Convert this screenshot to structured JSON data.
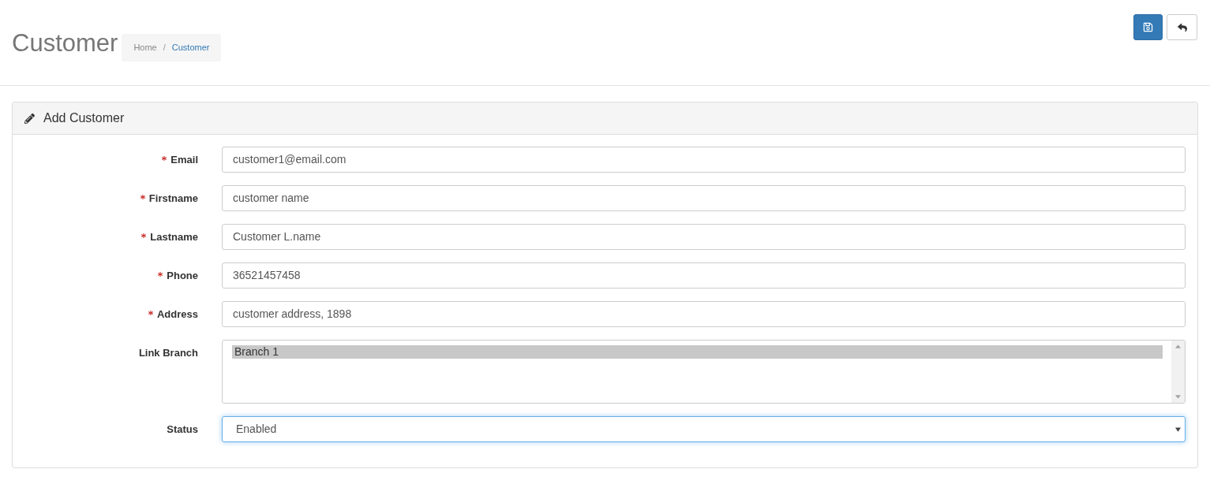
{
  "header": {
    "title": "Customer",
    "breadcrumb": {
      "separator": "/",
      "items": [
        {
          "label": "Home",
          "selected": false
        },
        {
          "label": "Customer",
          "selected": true
        }
      ]
    },
    "toolbar": [
      {
        "kind": "save"
      },
      {
        "kind": "back"
      }
    ]
  },
  "panel": {
    "title": "Add Customer",
    "fields": [
      {
        "kind": "text",
        "label": "Email",
        "required": true,
        "focused": false,
        "value": "customer1@email.com"
      },
      {
        "kind": "text",
        "label": "Firstname",
        "required": true,
        "focused": false,
        "value": "customer name"
      },
      {
        "kind": "text",
        "label": "Lastname",
        "required": true,
        "focused": false,
        "value": "Customer L.name"
      },
      {
        "kind": "text",
        "label": "Phone",
        "required": true,
        "focused": false,
        "value": "36521457458"
      },
      {
        "kind": "text",
        "label": "Address",
        "required": true,
        "focused": false,
        "value": "customer address, 1898"
      },
      {
        "kind": "multiselect",
        "label": "Link Branch",
        "required": false,
        "focused": false,
        "options": [
          {
            "label": "Branch 1",
            "selected": true
          }
        ]
      },
      {
        "kind": "select",
        "label": "Status",
        "required": false,
        "focused": true,
        "value": "Enabled"
      }
    ]
  }
}
